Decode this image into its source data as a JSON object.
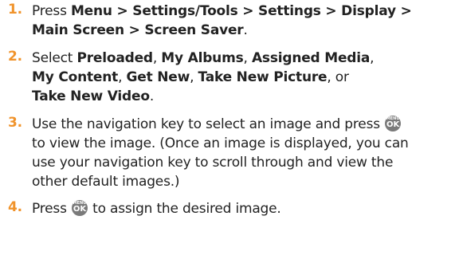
{
  "step1": {
    "number": "1.",
    "pre": "Press ",
    "path": "Menu > Settings/Tools > Settings > Display >",
    "path2": "Main Screen > Screen Saver",
    "post": "."
  },
  "step2": {
    "number": "2.",
    "select": "Select ",
    "opt1": "Preloaded",
    "sep": ", ",
    "opt2": "My Albums",
    "opt3": "Assigned Media",
    "trail1": ",",
    "opt4": "My Content",
    "opt5": "Get New",
    "opt6": "Take New Picture",
    "or": ", or",
    "opt7": "Take New Video",
    "end": "."
  },
  "step3": {
    "number": "3.",
    "line1": "Use the navigation key to select an image and press ",
    "line2": "to view the image. (Once an image is displayed, you can",
    "line3": "use your navigation key to scroll through and view the",
    "line4": "other default images.)"
  },
  "step4": {
    "number": "4.",
    "pre": "Press ",
    "post": " to assign the desired image."
  },
  "menu_key": {
    "top": "MENU",
    "bottom": "OK",
    "icon": "menu-ok-key-icon"
  },
  "colors": {
    "step_number": "#f0932b",
    "text": "#222222",
    "key_fill": "#7a7a7a"
  }
}
